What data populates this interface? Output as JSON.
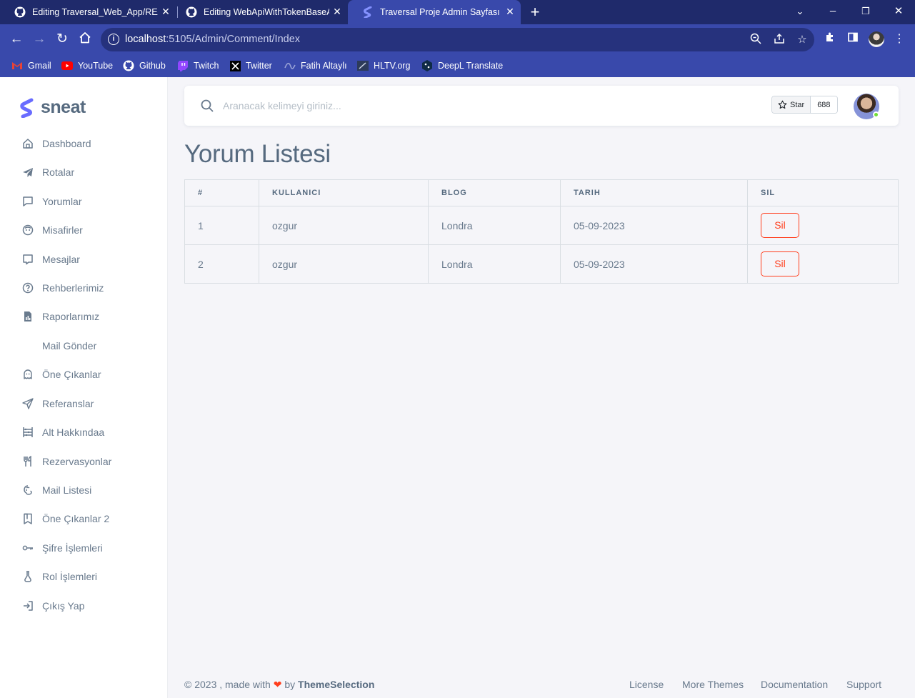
{
  "browser": {
    "tabs": [
      {
        "title": "Editing Traversal_Web_App/README",
        "icon": "github-icon"
      },
      {
        "title": "Editing WebApiWithTokenBaseAuth",
        "icon": "github-icon"
      },
      {
        "title": "Traversal Proje Admin Sayfası",
        "icon": "sneat-icon"
      }
    ],
    "url_host": "localhost",
    "url_path": ":5105/Admin/Comment/Index",
    "bookmarks": [
      {
        "label": "Gmail",
        "icon": "gmail-icon"
      },
      {
        "label": "YouTube",
        "icon": "youtube-icon"
      },
      {
        "label": "Github",
        "icon": "github-icon"
      },
      {
        "label": "Twitch",
        "icon": "twitch-icon"
      },
      {
        "label": "Twitter",
        "icon": "x-icon"
      },
      {
        "label": "Fatih Altaylı",
        "icon": "fatih-icon"
      },
      {
        "label": "HLTV.org",
        "icon": "hltv-icon"
      },
      {
        "label": "DeepL Translate",
        "icon": "deepl-icon"
      }
    ]
  },
  "sidebar": {
    "brand": "sneat",
    "items": [
      {
        "label": "Dashboard",
        "icon": "home-icon"
      },
      {
        "label": "Rotalar",
        "icon": "plane-icon"
      },
      {
        "label": "Yorumlar",
        "icon": "comment-icon"
      },
      {
        "label": "Misafirler",
        "icon": "face-icon"
      },
      {
        "label": "Mesajlar",
        "icon": "message-icon"
      },
      {
        "label": "Rehberlerimiz",
        "icon": "help-icon"
      },
      {
        "label": "Raporlarımız",
        "icon": "report-icon"
      },
      {
        "label": "Mail Gönder",
        "icon": ""
      },
      {
        "label": "Öne Çıkanlar",
        "icon": "ghost-icon"
      },
      {
        "label": "Referanslar",
        "icon": "send-icon"
      },
      {
        "label": "Alt Hakkındaa",
        "icon": "abacus-icon"
      },
      {
        "label": "Rezervasyonlar",
        "icon": "restaurant-icon"
      },
      {
        "label": "Mail Listesi",
        "icon": "mail-chimp-icon"
      },
      {
        "label": "Öne Çıkanlar 2",
        "icon": "bookmark-icon"
      },
      {
        "label": "Şifre İşlemleri",
        "icon": "key-icon"
      },
      {
        "label": "Rol İşlemleri",
        "icon": "vial-icon"
      },
      {
        "label": "Çıkış Yap",
        "icon": "logout-icon"
      }
    ]
  },
  "navbar": {
    "search_placeholder": "Aranacak kelimeyi giriniz...",
    "star_label": "Star",
    "star_count": "688"
  },
  "main": {
    "title": "Yorum Listesi",
    "columns": [
      "#",
      "KULLANICI",
      "BLOG",
      "TARIH",
      "SIL"
    ],
    "rows": [
      {
        "id": "1",
        "user": "ozgur",
        "blog": "Londra",
        "date": "05-09-2023",
        "action": "Sil"
      },
      {
        "id": "2",
        "user": "ozgur",
        "blog": "Londra",
        "date": "05-09-2023",
        "action": "Sil"
      }
    ]
  },
  "footer": {
    "copyright": "© 2023 , made with",
    "by": "by",
    "brand": "ThemeSelection",
    "links": [
      "License",
      "More Themes",
      "Documentation",
      "Support"
    ]
  },
  "colors": {
    "chrome_dark": "#1f2a6b",
    "chrome": "#3949ab",
    "danger": "#ff3e1d",
    "text": "#697a8d",
    "heading": "#566a7f"
  }
}
